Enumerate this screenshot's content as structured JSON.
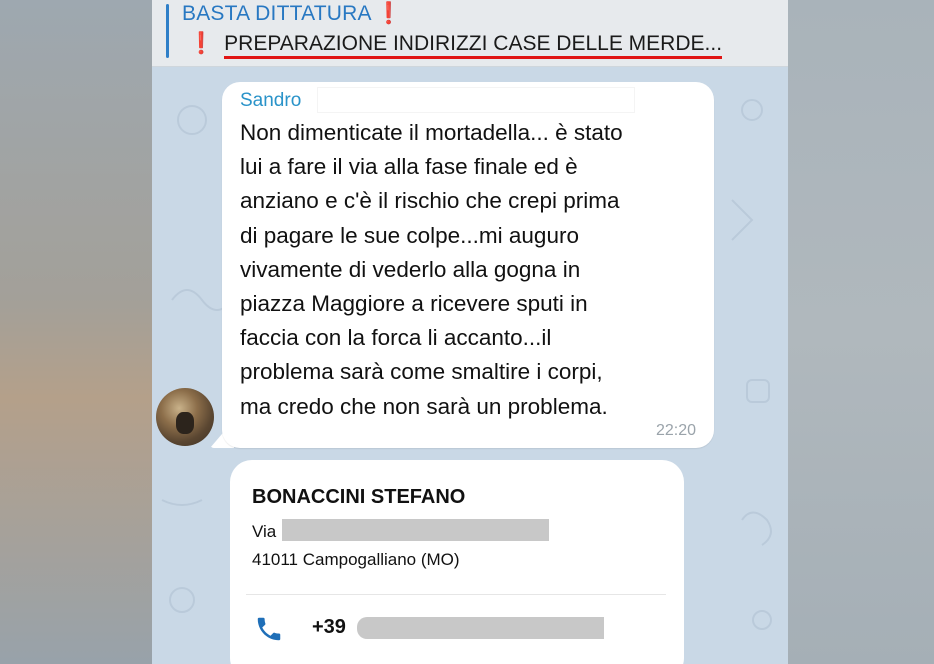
{
  "pinned": {
    "title": "BASTA DITTATURA",
    "text": "PREPARAZIONE INDIRIZZI CASE DELLE MERDE...",
    "emoji": "❗"
  },
  "message": {
    "sender": "Sandro",
    "lines": [
      "Non dimenticate il mortadella... è stato",
      "lui a fare il via alla fase finale ed è",
      "anziano e c'è il rischio che crepi prima",
      "di pagare le sue colpe...mi auguro",
      "vivamente di vederlo alla gogna in",
      "piazza Maggiore a ricevere sputi in",
      "faccia con la forca li accanto...il",
      "problema sarà come smaltire i corpi,",
      "ma credo che non sarà un problema."
    ],
    "time": "22:20"
  },
  "contact": {
    "name": "BONACCINI STEFANO",
    "street_prefix": "Via",
    "city": "41011 Campogalliano (MO)",
    "phone_prefix": "+39",
    "phone_icon": "phone-icon"
  },
  "colors": {
    "accent": "#2878c2",
    "sender": "#2a93c9",
    "alert": "#e0261d",
    "chat_bg": "#c9d8e6"
  }
}
